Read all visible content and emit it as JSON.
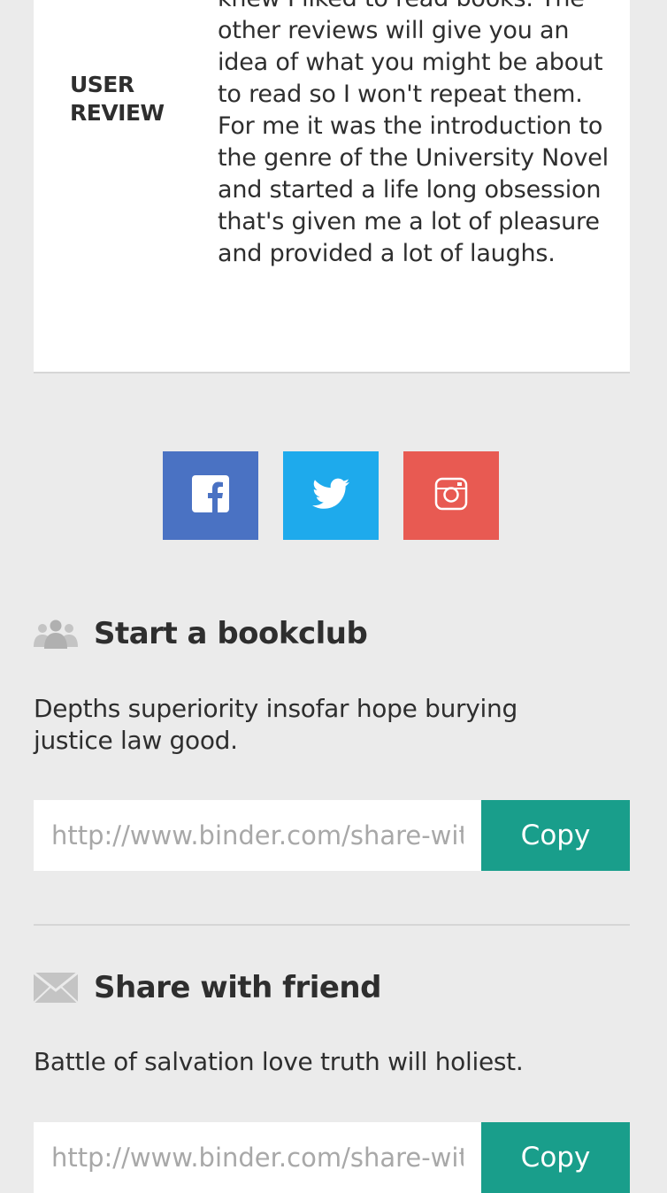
{
  "review": {
    "label": "USER REVIEW",
    "text": "knew I liked to read books. The other reviews will give you an idea of what you might be about to read so I won't repeat them. For me it was the introduction to the genre of the University Novel and started a life long obsession that's given me a lot of pleasure and provided a lot of laughs."
  },
  "social": {
    "buttons": [
      {
        "name": "facebook",
        "icon": "facebook-icon",
        "color": "#4a72c3"
      },
      {
        "name": "twitter",
        "icon": "twitter-icon",
        "color": "#1eaaec"
      },
      {
        "name": "instagram",
        "icon": "instagram-icon",
        "color": "#e85a52"
      }
    ]
  },
  "bookclub": {
    "icon": "group-icon",
    "title": "Start a bookclub",
    "description": "Depths superiority insofar hope burying justice law good.",
    "link_value": "http://www.binder.com/share-with-friends",
    "copy_label": "Copy"
  },
  "share_friend": {
    "icon": "envelope-icon",
    "title": "Share with friend",
    "description": "Battle of salvation love truth will holiest.",
    "link_value": "http://www.binder.com/share-with-friends",
    "copy_label": "Copy"
  },
  "colors": {
    "background": "#ebebeb",
    "copy_button": "#199e8b",
    "facebook": "#4a72c3",
    "twitter": "#1eaaec",
    "instagram": "#e85a52"
  }
}
